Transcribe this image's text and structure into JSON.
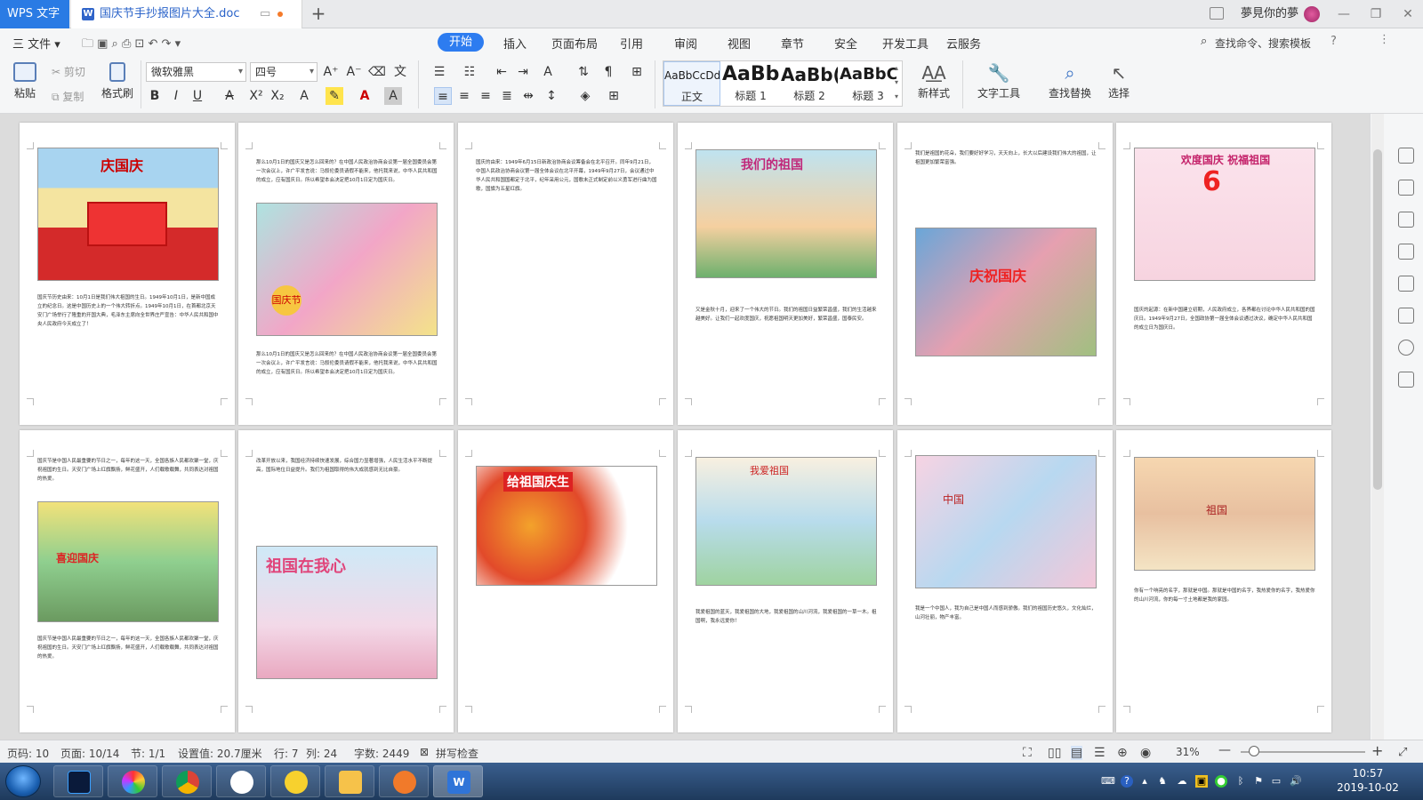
{
  "titlebar": {
    "app_name": "WPS 文字",
    "doc_tab": "国庆节手抄报图片大全.doc",
    "new_tab": "+",
    "user_name": "夢見你的夢",
    "win_min": "—",
    "win_max": "❐",
    "win_close": "✕"
  },
  "menu": {
    "file": "三 文件 ▾",
    "items": [
      "开始",
      "插入",
      "页面布局",
      "引用",
      "审阅",
      "视图",
      "章节",
      "安全",
      "开发工具",
      "云服务"
    ],
    "search": "查找命令、搜索模板"
  },
  "ribbon": {
    "paste": "粘贴",
    "cut": "剪切",
    "copy": "复制",
    "format_painter": "格式刷",
    "font_name": "微软雅黑",
    "font_size": "四号",
    "styles": [
      {
        "sample": "AaBbCcDd",
        "label": "正文"
      },
      {
        "sample": "AaBb",
        "label": "标题 1"
      },
      {
        "sample": "AaBb(",
        "label": "标题 2"
      },
      {
        "sample": "AaBbC(",
        "label": "标题 3"
      }
    ],
    "new_style": "新样式",
    "text_tools": "文字工具",
    "find_replace": "查找替换",
    "select": "选择"
  },
  "pages": [
    {
      "image_label": "庆国庆",
      "text": "国庆节历史由来：10月1日是我们伟大祖国的生日。1949年10月1日，是新中国成立的纪念日。这是中国历史上的一个伟大转折点。1949年10月1日，在首都北京天安门广场举行了隆重的开国大典，毛泽东主席向全世界庄严宣告：中华人民共和国中央人民政府今天成立了！"
    },
    {
      "image_label": "国庆节",
      "text": "那么10月1日的国庆又是怎么回来的？在中国人民政治协商会议第一届全国委员会第一次会议上，许广平发言说：马叙伦委员请假不能来，他托我来说，中华人民共和国的成立，应有国庆日。所以希望本会决定把10月1日定为国庆日。"
    },
    {
      "image_label": "",
      "text": "国庆的由来：1949年6月15日新政治协商会议筹备会在北平召开。同年9月21日，中国人民政治协商会议第一届全体会议在北平开幕，1949年9月27日，会议通过中华人民共和国国都定于北平，纪年采用公元，国歌未正式制定前以义勇军进行曲为国歌，国旗为五星红旗。"
    },
    {
      "image_label": "我们的祖国",
      "text": "又是金秋十月，迎来了一个伟大的节日。我们的祖国日益繁荣昌盛，我们的生活越来越美好。让我们一起欢度国庆，祝愿祖国明天更加美好，繁荣昌盛，国泰民安。"
    },
    {
      "image_label": "庆祝国庆",
      "text": "我们是祖国的花朵，我们要好好学习，天天向上，长大以后建设我们伟大的祖国，让祖国更加繁荣富强。"
    },
    {
      "image_label": "欢度国庆 祝福祖国",
      "text": "国庆的起源：在新中国建立初期，人民政府成立，各界都在讨论中华人民共和国的国庆日。1949年9月27日，全国政协第一届全体会议通过决议，确定中华人民共和国的成立日为国庆日。"
    },
    {
      "image_label": "喜迎国庆",
      "text": "国庆节是中国人民最重要的节日之一，每年的这一天，全国各族人民都欢聚一堂，庆祝祖国的生日。天安门广场上红旗飘扬，鲜花盛开，人们载歌载舞，共同表达对祖国的热爱。"
    },
    {
      "image_label": "祖国在我心",
      "text": "改革开放以来，我国经济持续快速发展，综合国力显著增强，人民生活水平不断提高，国际地位日益提升。我们为祖国取得的伟大成就感到无比自豪。"
    },
    {
      "image_label": "给祖国庆生",
      "text": ""
    },
    {
      "image_label": "我爱祖国",
      "text": "我爱祖国的蓝天，我爱祖国的大地，我爱祖国的山川河流，我爱祖国的一草一木。祖国啊，我永远爱你！"
    },
    {
      "image_label": "中国",
      "text": "我是一个中国人，我为自己是中国人而感到骄傲。我们的祖国历史悠久，文化灿烂，山河壮丽，物产丰富。"
    },
    {
      "image_label": "祖国",
      "text": "你有一个响亮的名字，那就是中国。那就是中国的名字，我热爱你的名字，我热爱你的山川河流，你的每一寸土地都是我的家园。"
    }
  ],
  "status": {
    "page_num": "页码: 10",
    "page_of": "页面: 10/14",
    "section": "节: 1/1",
    "setting": "设置值: 20.7厘米",
    "row": "行: 7",
    "col": "列: 24",
    "words": "字数: 2449",
    "spell": "拼写检查",
    "zoom": "31%"
  },
  "taskbar": {
    "time": "10:57",
    "date": "2019-10-02"
  },
  "colors": {
    "accent": "#2d7cf0",
    "app_tab": "#2a7be4",
    "taskbar": "#1e3a5c"
  }
}
